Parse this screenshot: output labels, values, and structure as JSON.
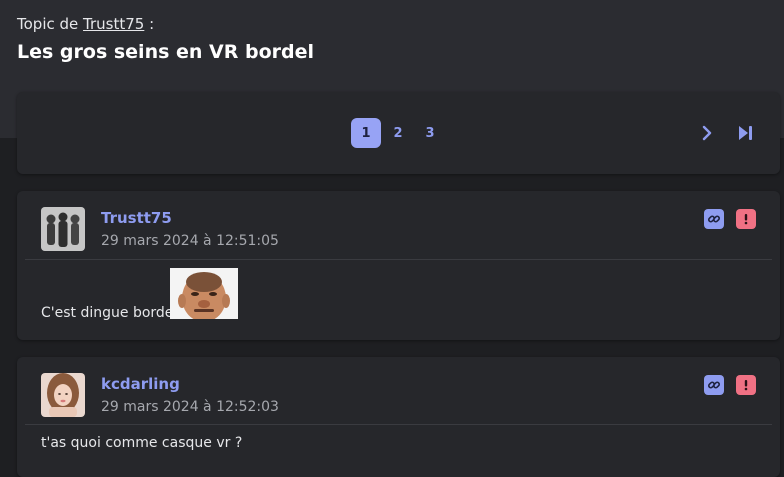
{
  "topic": {
    "prefix": "Topic de",
    "author": "Trustt75",
    "suffix": " :",
    "title": "Les gros seins en VR bordel"
  },
  "pagination": {
    "pages": [
      "1",
      "2",
      "3"
    ],
    "active_page": "1"
  },
  "posts": [
    {
      "author": "Trustt75",
      "date": "29 mars 2024 à 12:51:05",
      "text": "C'est dingue bordel"
    },
    {
      "author": "kcdarling",
      "date": "29 mars 2024 à 12:52:03",
      "text": "t'as quoi comme casque vr ?"
    }
  ],
  "colors": {
    "accent": "#8e9cf0",
    "report": "#f07184",
    "background": "#1e1f22",
    "card": "#26272b"
  },
  "icons": {
    "next": "chevron-right-icon",
    "last": "skip-to-end-icon",
    "link": "link-icon",
    "report": "exclamation-icon"
  }
}
